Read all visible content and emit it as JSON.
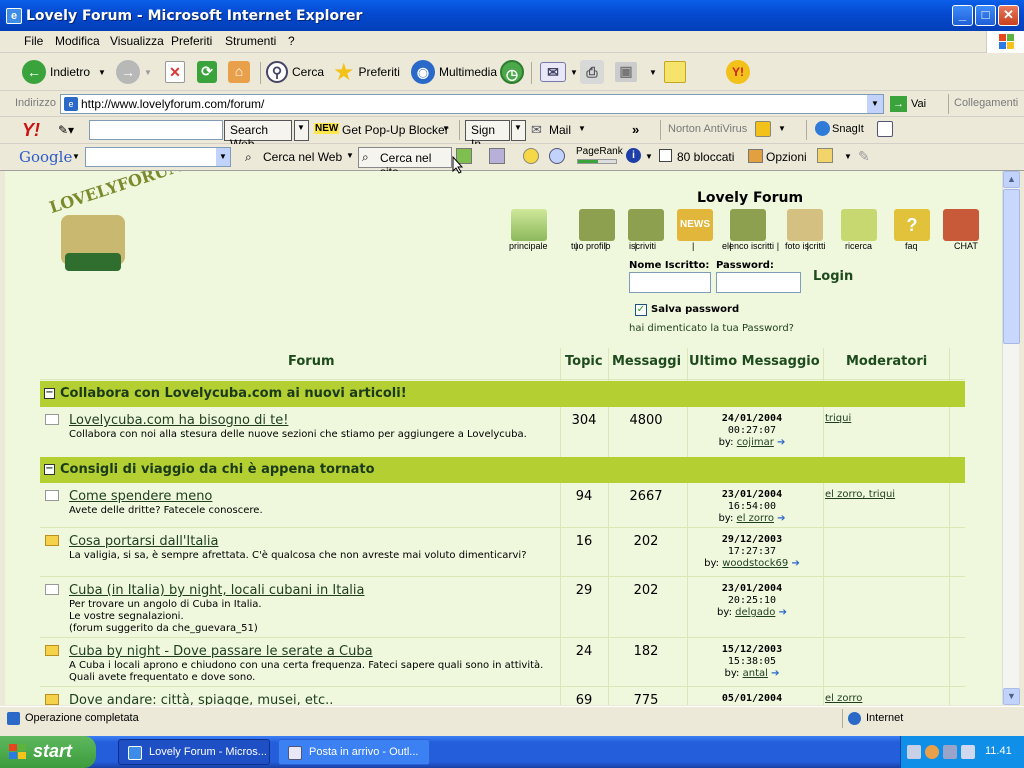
{
  "window": {
    "title": "Lovely Forum - Microsoft Internet Explorer"
  },
  "menu": [
    "File",
    "Modifica",
    "Visualizza",
    "Preferiti",
    "Strumenti",
    "?"
  ],
  "toolbar": {
    "back": "Indietro",
    "search": "Cerca",
    "favorites": "Preferiti",
    "media": "Multimedia"
  },
  "address": {
    "label": "Indirizzo",
    "url": "http://www.lovelyforum.com/forum/",
    "go": "Vai",
    "links": "Collegamenti"
  },
  "yahoo": {
    "search_btn": "Search Web",
    "popup": "Get Pop-Up Blocker",
    "new": "NEW",
    "signin": "Sign In",
    "mail": "Mail",
    "norton": "Norton AntiVirus",
    "snagit": "SnagIt"
  },
  "google": {
    "logo": "Google",
    "web": "Cerca nel Web",
    "site": "Cerca nel sito",
    "pagerank": "PageRank",
    "blocked": "80 bloccati",
    "options": "Opzioni"
  },
  "forum": {
    "title": "Lovely Forum",
    "logo_text": "LOVELYFORUM",
    "nav": [
      "principale",
      "tuo profilo",
      "iscriviti",
      "elenco iscritti",
      "foto iscritti",
      "ricerca",
      "faq",
      "CHAT"
    ],
    "nav_news": "NEWS",
    "login": {
      "user_label": "Nome Iscritto:",
      "pass_label": "Password:",
      "button": "Login",
      "remember": "Salva password",
      "forgot": "hai dimenticato la tua Password?"
    },
    "headers": {
      "forum": "Forum",
      "topic": "Topic",
      "messages": "Messaggi",
      "last": "Ultimo Messaggio",
      "mods": "Moderatori"
    },
    "categories": [
      {
        "name": "Collabora con Lovelycuba.com ai nuovi articoli!"
      },
      {
        "name": "Consigli di viaggio da chi è appena tornato"
      }
    ],
    "rows": [
      {
        "name": "Lovelycuba.com ha bisogno di te!",
        "desc": "Collabora con noi alla stesura delle nuove sezioni che stiamo per aggiungere a Lovelycuba.",
        "topics": "304",
        "messages": "4800",
        "date": "24/01/2004",
        "time": "00:27:07",
        "by": "cojimar",
        "mods": "triqui"
      },
      {
        "name": "Come spendere meno",
        "desc": "Avete delle dritte? Fatecele conoscere.",
        "topics": "94",
        "messages": "2667",
        "date": "23/01/2004",
        "time": "16:54:00",
        "by": "el zorro",
        "mods": "el zorro, triqui"
      },
      {
        "name": "Cosa portarsi dall'Italia",
        "desc": "La valigia, si sa, è sempre afrettata. C'è qualcosa che non avreste mai voluto dimenticarvi?",
        "topics": "16",
        "messages": "202",
        "date": "29/12/2003",
        "time": "17:27:37",
        "by": "woodstock69",
        "mods": ""
      },
      {
        "name": "Cuba (in Italia) by night, locali cubani in Italia",
        "desc": "Per trovare un angolo di Cuba in Italia.\nLe vostre segnalazioni.\n(forum suggerito da che_guevara_51)",
        "topics": "29",
        "messages": "202",
        "date": "23/01/2004",
        "time": "20:25:10",
        "by": "delgado",
        "mods": ""
      },
      {
        "name": "Cuba by night - Dove passare le serate a Cuba",
        "desc": "A Cuba i locali aprono e chiudono con una certa frequenza. Fateci sapere quali sono in attività. Quali avete frequentato e dove sono.",
        "topics": "24",
        "messages": "182",
        "date": "15/12/2003",
        "time": "15:38:05",
        "by": "antal",
        "mods": ""
      },
      {
        "name": "Dove andare: città, spiagge, musei, etc..",
        "desc": "",
        "topics": "69",
        "messages": "775",
        "date": "05/01/2004",
        "time": "",
        "by": "",
        "mods": "el zorro"
      }
    ],
    "by_label": "by:"
  },
  "status": {
    "text": "Operazione completata",
    "zone": "Internet"
  },
  "taskbar": {
    "start": "start",
    "tasks": [
      "Lovely Forum - Micros...",
      "Posta in arrivo - Outl..."
    ],
    "clock": "11.41"
  }
}
